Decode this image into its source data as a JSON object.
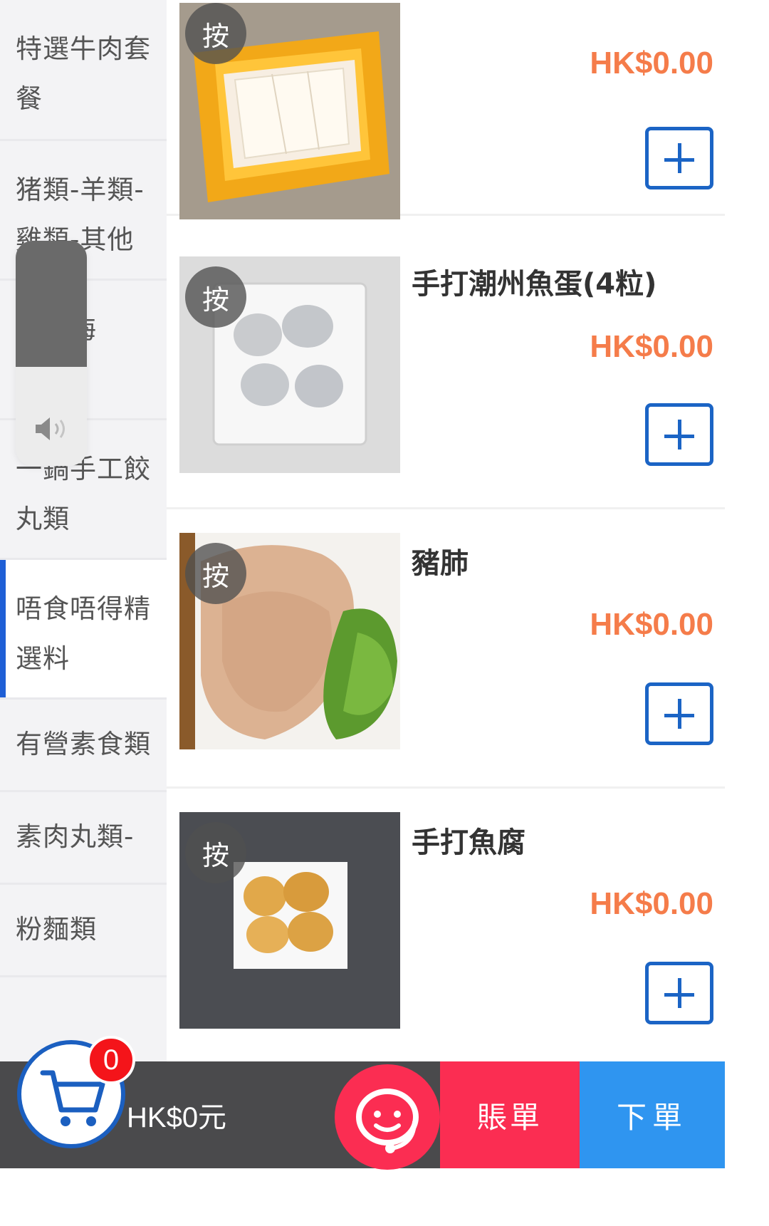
{
  "sidebar": {
    "categories": [
      {
        "label": "特選牛肉套餐"
      },
      {
        "label": "猪類-羊類-雞類-其他"
      },
      {
        "label": "手作海"
      },
      {
        "label": "一鍋手工餃丸類"
      },
      {
        "label": "唔食唔得精選料"
      },
      {
        "label": "有營素食類"
      },
      {
        "label": "素肉丸類-"
      },
      {
        "label": "粉麵類"
      }
    ],
    "active_index": 4
  },
  "volume_overlay": {
    "level": 0.56,
    "icon": "speaker-icon"
  },
  "items": [
    {
      "name": "",
      "price": "HK$0.00",
      "badge": "按",
      "add_icon": "plus-icon"
    },
    {
      "name": "手打潮州魚蛋(4粒)",
      "price": "HK$0.00",
      "badge": "按",
      "add_icon": "plus-icon"
    },
    {
      "name": "豬肺",
      "price": "HK$0.00",
      "badge": "按",
      "add_icon": "plus-icon"
    },
    {
      "name": "手打魚腐",
      "price": "HK$0.00",
      "badge": "按",
      "add_icon": "plus-icon"
    }
  ],
  "bottom_bar": {
    "cart_count": "0",
    "cart_total": "HK$0元",
    "bill_label": "賬單",
    "order_label": "下單",
    "support_icon": "customer-service-icon",
    "cart_icon": "cart-icon"
  },
  "colors": {
    "price": "#f57c4a",
    "accent_blue": "#1b64c5",
    "bill_red": "#fb2d52",
    "order_blue": "#2f95f0",
    "bar_dark": "#4a4a4c"
  }
}
